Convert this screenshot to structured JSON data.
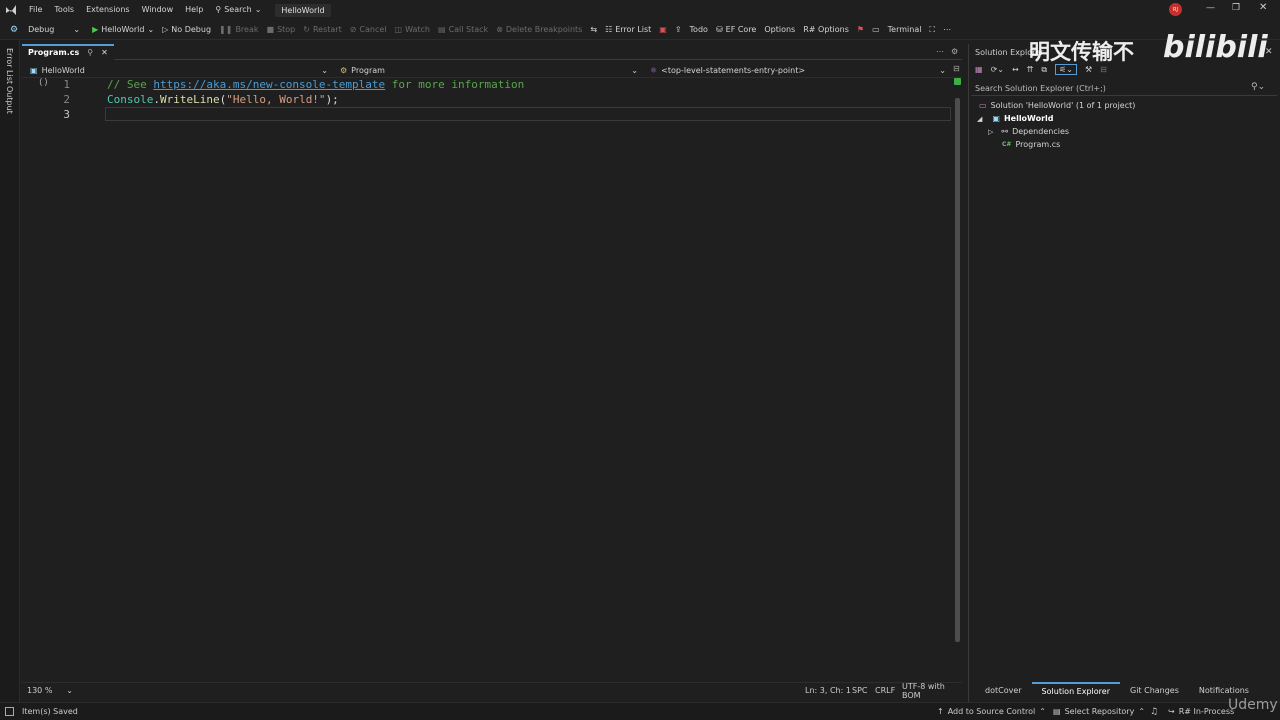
{
  "menu": [
    "File",
    "Tools",
    "Extensions",
    "Window",
    "Help"
  ],
  "search_label": "Search",
  "solution_title": "HelloWorld",
  "avatar_initials": "RJ",
  "toolbar": {
    "config": "Debug",
    "run": "HelloWorld",
    "no_debug": "No Debug",
    "break": "Break",
    "stop": "Stop",
    "restart": "Restart",
    "cancel": "Cancel",
    "watch": "Watch",
    "call_stack": "Call Stack",
    "delete_breakpoints": "Delete Breakpoints",
    "error_list": "Error List",
    "todo": "Todo",
    "ef_core": "EF Core",
    "options": "Options",
    "r_options": "R# Options",
    "terminal": "Terminal"
  },
  "side_tabs": [
    "Error List",
    "Output"
  ],
  "editor_tab": "Program.cs",
  "nav": {
    "project": "HelloWorld",
    "type": "Program",
    "member": "<top-level-statements-entry-point>"
  },
  "code": {
    "line_numbers": [
      "1",
      "2",
      "3"
    ],
    "l1_comment": "// See ",
    "l1_link": "https://aka.ms/new-console-template",
    "l1_rest": " for more information",
    "l2_class": "Console",
    "l2_dot": ".",
    "l2_method": "WriteLine",
    "l2_open": "(",
    "l2_str": "\"Hello, World!\"",
    "l2_close": ");"
  },
  "status": {
    "zoom": "130 %",
    "position": "Ln: 3, Ch: 1",
    "spc": "SPC",
    "crlf": "CRLF",
    "encoding": "UTF-8 with BOM"
  },
  "solution_explorer": {
    "title": "Solution Explorer",
    "search_placeholder": "Search Solution Explorer (Ctrl+;)",
    "solution": "Solution 'HelloWorld' (1 of 1 project)",
    "project": "HelloWorld",
    "dependencies": "Dependencies",
    "file": "Program.cs",
    "file_badge": "C#"
  },
  "watermark": {
    "text": "明文传输不",
    "logo": "bilibili",
    "udemy": "Udemy"
  },
  "panel_tabs": [
    "dotCover",
    "Solution Explorer",
    "Git Changes",
    "Notifications"
  ],
  "bottom": {
    "saved": "Item(s) Saved",
    "source_control": "Add to Source Control",
    "repository": "Select Repository",
    "resharper": "R# In-Process"
  },
  "colors": {
    "accent": "#569cd6",
    "comment": "#57a64a",
    "link": "#4a9cd6",
    "class": "#4ec9b0",
    "method": "#dcdcaa",
    "string": "#d69d85"
  }
}
